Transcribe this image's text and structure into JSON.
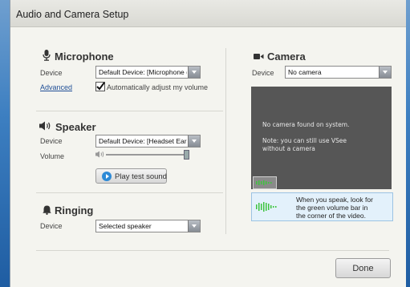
{
  "window": {
    "title": "Audio and Camera Setup"
  },
  "microphone": {
    "heading": "Microphone",
    "device_label": "Device",
    "device_value": "Default Device: [Microphone (Sou",
    "advanced_link": "Advanced",
    "auto_adjust_label": "Automatically adjust my volume",
    "auto_adjust_checked": true
  },
  "speaker": {
    "heading": "Speaker",
    "device_label": "Device",
    "device_value": "Default Device: [Headset Earphone",
    "volume_label": "Volume",
    "volume_level": 1.0,
    "play_button": "Play test sound"
  },
  "ringing": {
    "heading": "Ringing",
    "device_label": "Device",
    "device_value": "Selected speaker"
  },
  "camera": {
    "heading": "Camera",
    "device_label": "Device",
    "device_value": "No camera",
    "preview_message": "No camera found on system.",
    "preview_note_line1": "Note: you can still use VSee",
    "preview_note_line2": "without a camera",
    "tip_line1": "When you speak, look for",
    "tip_line2": "the green volume bar in",
    "tip_line3": "the corner of the video."
  },
  "footer": {
    "done_button": "Done"
  },
  "colors": {
    "accent_blue": "#2d8ad6",
    "volume_green": "#3ec43e",
    "preview_bg": "#565656"
  }
}
